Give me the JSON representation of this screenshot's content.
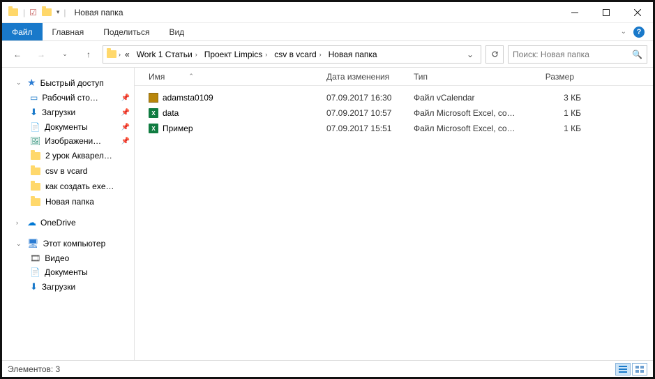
{
  "titlebar": {
    "title": "Новая папка"
  },
  "ribbon": {
    "file": "Файл",
    "home": "Главная",
    "share": "Поделиться",
    "view": "Вид"
  },
  "breadcrumb": {
    "segments": [
      "Work 1 Статьи",
      "Проект Limpics",
      "csv в vcard",
      "Новая папка"
    ],
    "prefix": "«"
  },
  "search": {
    "placeholder": "Поиск: Новая папка"
  },
  "columns": {
    "name": "Имя",
    "date": "Дата изменения",
    "type": "Тип",
    "size": "Размер"
  },
  "sidebar": {
    "quick": "Быстрый доступ",
    "quick_items": [
      {
        "label": "Рабочий сто…",
        "icon": "desktop",
        "pinned": true
      },
      {
        "label": "Загрузки",
        "icon": "downloads",
        "pinned": true
      },
      {
        "label": "Документы",
        "icon": "documents",
        "pinned": true
      },
      {
        "label": "Изображени…",
        "icon": "images",
        "pinned": true
      },
      {
        "label": "2 урок Акварел…",
        "icon": "folder",
        "pinned": false
      },
      {
        "label": "csv в vcard",
        "icon": "folder",
        "pinned": false
      },
      {
        "label": "как создать exe…",
        "icon": "folder",
        "pinned": false
      },
      {
        "label": "Новая папка",
        "icon": "folder",
        "pinned": false
      }
    ],
    "onedrive": "OneDrive",
    "thispc": "Этот компьютер",
    "pc_items": [
      {
        "label": "Видео",
        "icon": "video"
      },
      {
        "label": "Документы",
        "icon": "documents"
      },
      {
        "label": "Загрузки",
        "icon": "downloads"
      }
    ]
  },
  "files": [
    {
      "name": "adamsta0109",
      "date": "07.09.2017 16:30",
      "type": "Файл vCalendar",
      "size": "3 КБ",
      "icon": "vcal"
    },
    {
      "name": "data",
      "date": "07.09.2017 10:57",
      "type": "Файл Microsoft Excel, co…",
      "size": "1 КБ",
      "icon": "excel"
    },
    {
      "name": "Пример",
      "date": "07.09.2017 15:51",
      "type": "Файл Microsoft Excel, co…",
      "size": "1 КБ",
      "icon": "excel"
    }
  ],
  "statusbar": {
    "items_label": "Элементов: 3"
  }
}
